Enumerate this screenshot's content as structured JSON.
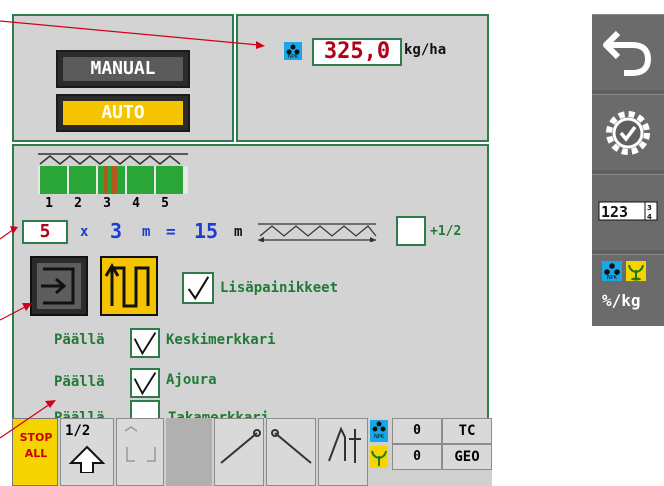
{
  "mode": {
    "manual_label": "MANUAL",
    "auto_label": "AUTO"
  },
  "rate": {
    "value": "325,0",
    "unit": "kg/ha",
    "icon_label": "NPK"
  },
  "sections": {
    "numbers": [
      "1",
      "2",
      "3",
      "4",
      "5"
    ],
    "count": "5",
    "times": "x",
    "width": "3",
    "m1": "m",
    "equals": "=",
    "total": "15",
    "m2": "m",
    "half_label": "+1/2"
  },
  "options": {
    "extra_buttons_label": "Lisäpainikkeet",
    "rows": [
      {
        "state": "Päällä",
        "label": "Keskimerkkari",
        "checked": true
      },
      {
        "state": "Päällä",
        "label": "Ajoura",
        "checked": true
      },
      {
        "state": "Päällä",
        "label": "Takamerkkari",
        "checked": false
      }
    ]
  },
  "sidebar": {
    "percent_kg_label": "%/kg",
    "npk_label": "NPK"
  },
  "toolbar": {
    "stop_top": "STOP",
    "stop_bottom": "ALL",
    "half_label": "1/2",
    "npk_label": "NPK",
    "counter_top": "0",
    "counter_bottom": "0",
    "tc_label": "TC",
    "geo_label": "GEO"
  },
  "colors": {
    "panel_border": "#2e7d4f",
    "auto_yellow": "#f5c400",
    "section_green": "#2aa639",
    "active_section": "#b05a1e",
    "value_red": "#b0001a",
    "value_blue": "#1a3fcf"
  }
}
